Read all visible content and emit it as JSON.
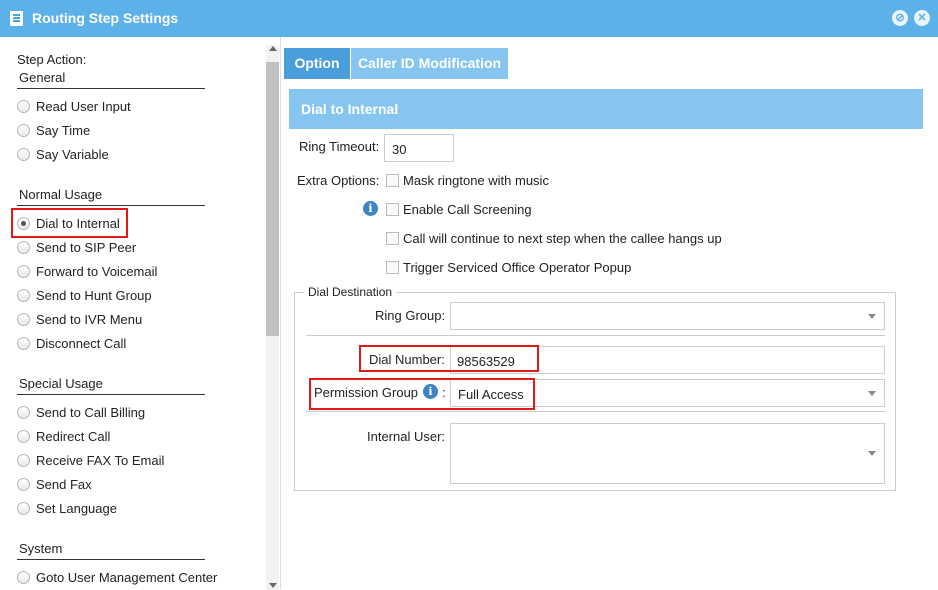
{
  "window": {
    "title": "Routing Step Settings",
    "minimize_glyph": "⊘",
    "close_glyph": "✕"
  },
  "left_panel": {
    "step_action_label": "Step Action:",
    "sections": [
      {
        "title": "General",
        "items": [
          "Read User Input",
          "Say Time",
          "Say Variable"
        ]
      },
      {
        "title": "Normal Usage",
        "items": [
          "Dial to Internal",
          "Send to SIP Peer",
          "Forward to Voicemail",
          "Send to Hunt Group",
          "Send to IVR Menu",
          "Disconnect Call"
        ]
      },
      {
        "title": "Special Usage",
        "items": [
          "Send to Call Billing",
          "Redirect Call",
          "Receive FAX To Email",
          "Send Fax",
          "Set Language"
        ]
      },
      {
        "title": "System",
        "items": [
          "Goto User Management Center"
        ]
      }
    ],
    "selected": "Dial to Internal"
  },
  "tabs": [
    {
      "label": "Option",
      "active": true
    },
    {
      "label": "Caller ID Modification",
      "active": false
    }
  ],
  "main": {
    "section_title": "Dial to Internal",
    "ring_timeout_label": "Ring Timeout:",
    "ring_timeout_value": "30",
    "extra_options_label": "Extra Options:",
    "options": [
      {
        "label": "Mask ringtone with music",
        "checked": false
      },
      {
        "label": "Enable Call Screening",
        "checked": false
      },
      {
        "label": "Call will continue to next step when the callee hangs up",
        "checked": false
      },
      {
        "label": "Trigger Serviced Office Operator Popup",
        "checked": false
      }
    ],
    "dial_destination": {
      "legend": "Dial Destination",
      "ring_group_label": "Ring Group:",
      "ring_group_value": "",
      "dial_number_label": "Dial Number:",
      "dial_number_value": "98563529",
      "permission_group_label": "Permission Group",
      "permission_group_colon": ":",
      "permission_group_value": "Full Access",
      "internal_user_label": "Internal User:",
      "internal_user_value": ""
    }
  },
  "colors": {
    "titlebar": "#5bb1e8",
    "tab_active": "#4a9edb",
    "tab_inactive": "#86c5ef",
    "section_header": "#86c5ef",
    "highlight_box": "#e01919"
  }
}
